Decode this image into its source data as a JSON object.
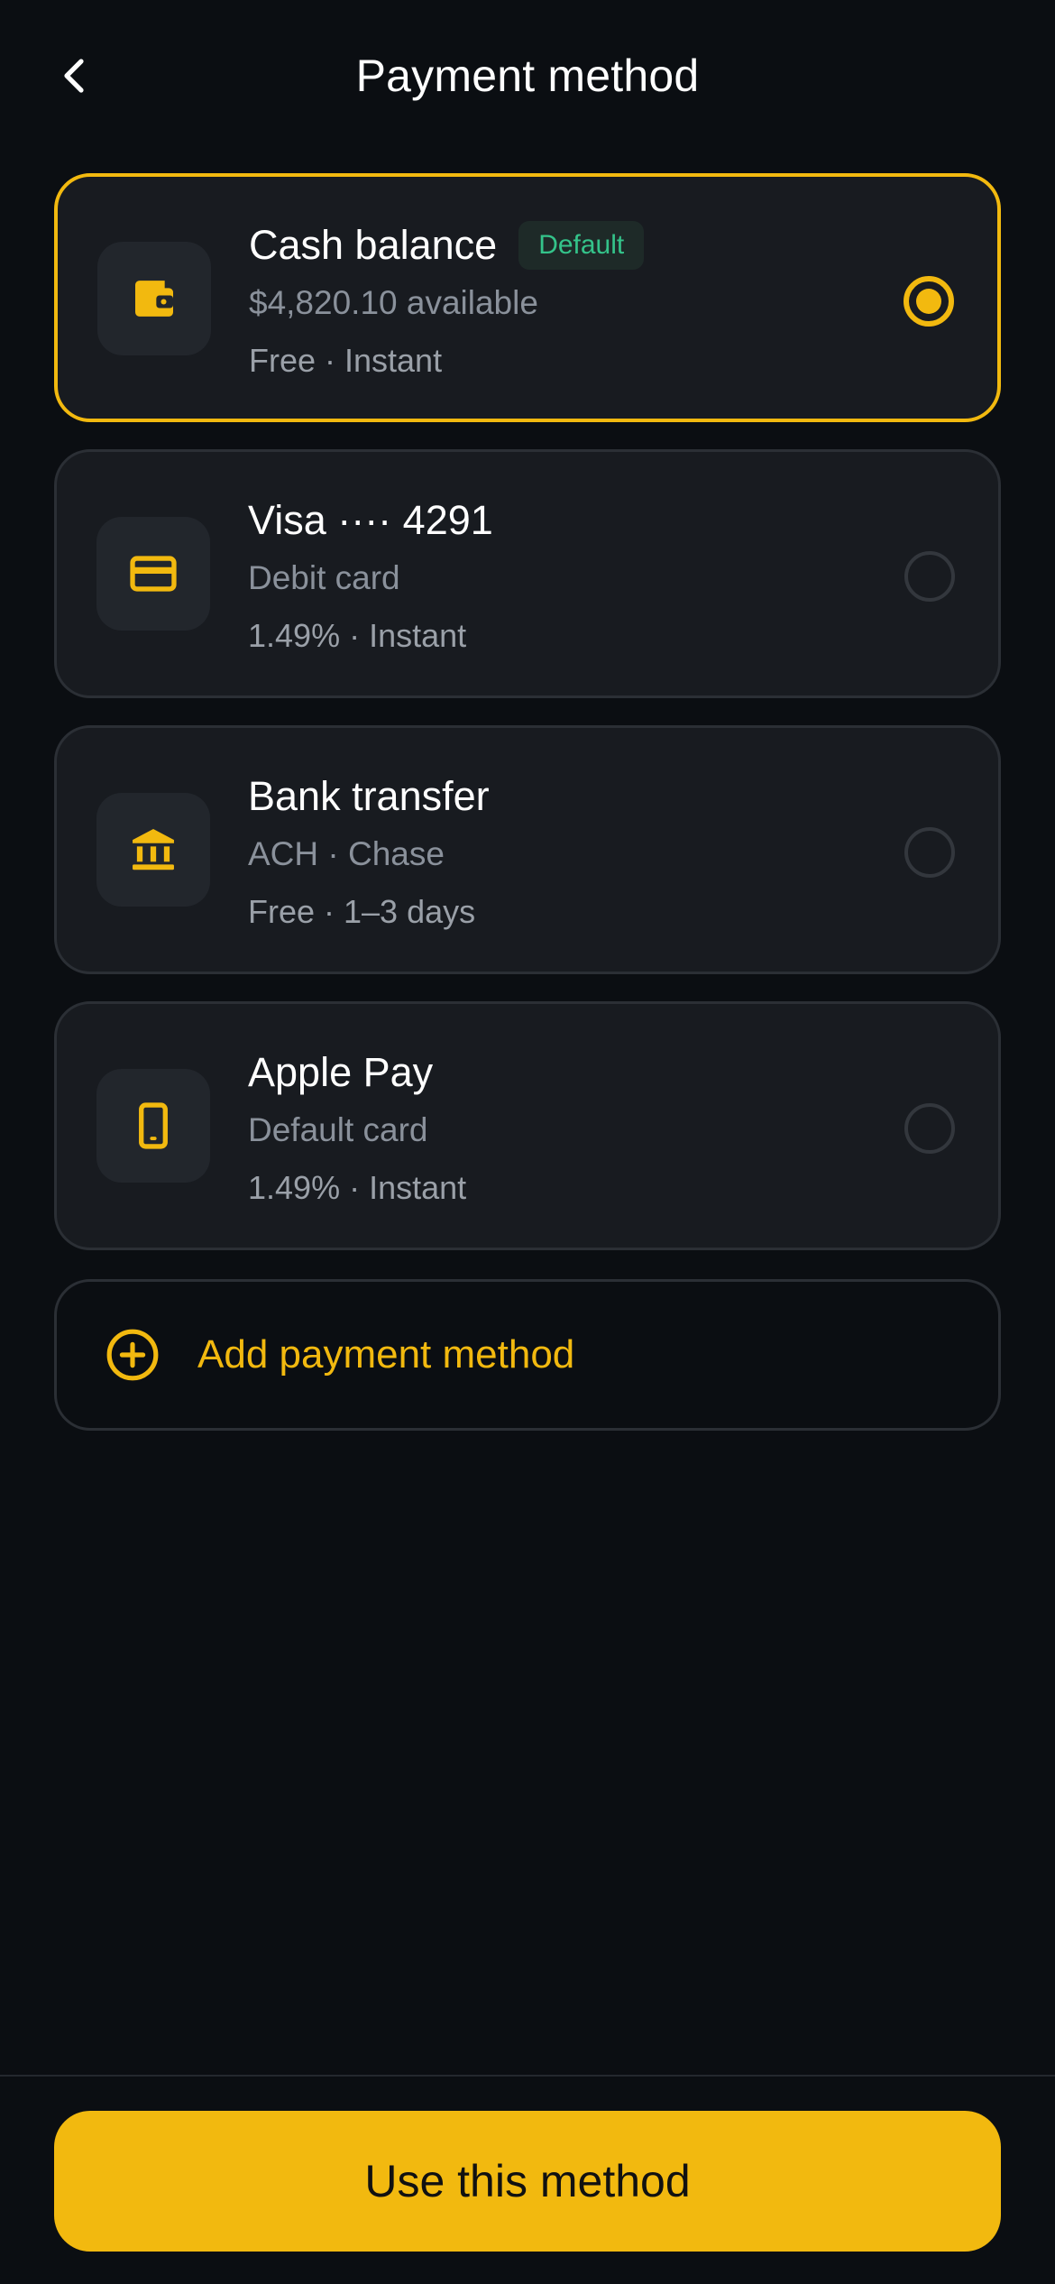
{
  "header": {
    "title": "Payment method"
  },
  "methods": [
    {
      "name": "Cash balance",
      "badge": "Default",
      "subtitle": "$4,820.10 available",
      "meta": "Free · Instant",
      "selected": true,
      "icon": "wallet-icon"
    },
    {
      "name": "Visa ···· 4291",
      "subtitle": "Debit card",
      "meta": "1.49% · Instant",
      "selected": false,
      "icon": "credit-card-icon"
    },
    {
      "name": "Bank transfer",
      "subtitle": "ACH · Chase",
      "meta": "Free · 1–3 days",
      "selected": false,
      "icon": "bank-icon"
    },
    {
      "name": "Apple Pay",
      "subtitle": "Default card",
      "meta": "1.49% · Instant",
      "selected": false,
      "icon": "smartphone-icon"
    }
  ],
  "add_method": {
    "label": "Add payment method",
    "icon": "plus-circle-icon"
  },
  "footer": {
    "cta_label": "Use this method"
  },
  "colors": {
    "accent": "#f2b90f",
    "badge_green": "#34c38a",
    "background": "#0b0e12",
    "card": "#181b20"
  }
}
